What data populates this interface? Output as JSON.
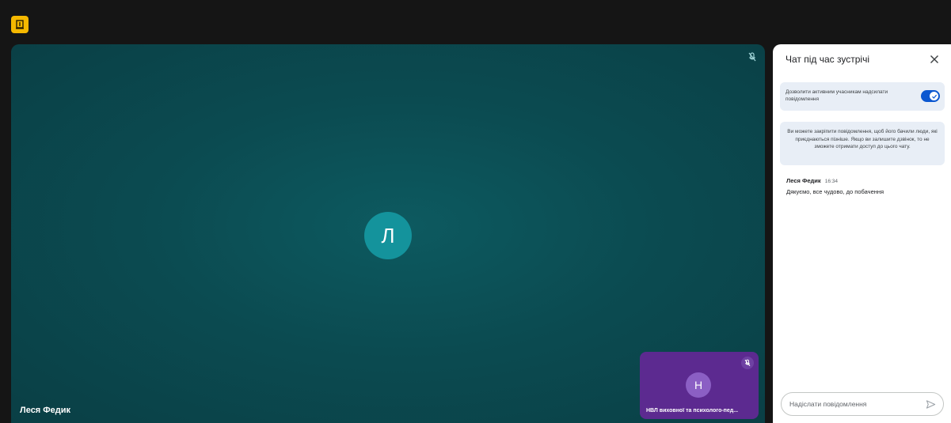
{
  "app": {
    "badge_icon": "meeting-app-icon",
    "badge_color": "#f5b800"
  },
  "main_tile": {
    "participant_name": "Леся Федик",
    "avatar_letter": "Л",
    "avatar_color": "#14939c",
    "background_color": "#0b4b51",
    "status_icon": "mic-off-icon"
  },
  "self_tile": {
    "participant_name": "НВЛ виховної та психолого-пед...",
    "avatar_letter": "Н",
    "avatar_color": "#8b5fc4",
    "background_color": "#5c2a90",
    "status_icon": "mic-off-icon"
  },
  "chat_panel": {
    "title": "Чат під час зустрічі",
    "close_icon": "close-icon",
    "setting": {
      "label": "Дозволити активним учасникам надсилати повідомлення",
      "enabled": true,
      "accent_color": "#0b57d0"
    },
    "info_text": "Ви можете закріпити повідомлення, щоб його бачили люди, які приєднаються пізніше. Якщо ви залишите дзвінок, то не зможете отримати доступ до цього чату.",
    "messages": [
      {
        "author": "Леся Федик",
        "time": "16:34",
        "text": "Дякуємо, все чудово, до побачення"
      }
    ],
    "composer": {
      "placeholder": "Надіслати повідомлення",
      "value": "",
      "send_icon": "send-icon"
    }
  }
}
